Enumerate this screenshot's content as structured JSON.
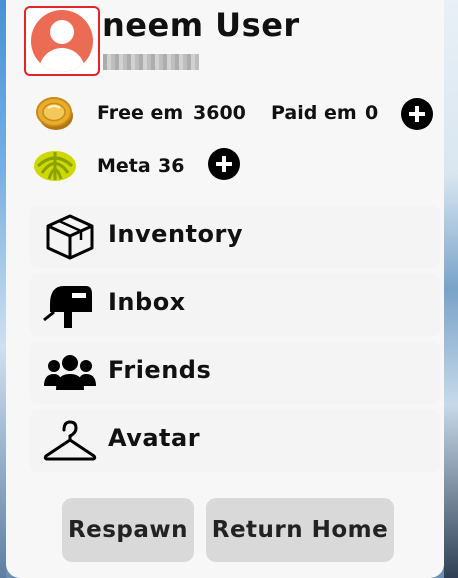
{
  "profile": {
    "username": "neem User",
    "avatar_icon": "user-avatar-icon"
  },
  "currency": {
    "free_label": "Free em",
    "free_value": "3600",
    "paid_label": "Paid em",
    "paid_value": "0",
    "meta_label": "Meta",
    "meta_value": "36"
  },
  "menu": {
    "items": [
      {
        "label": "Inventory",
        "icon": "box-icon"
      },
      {
        "label": "Inbox",
        "icon": "mailbox-icon"
      },
      {
        "label": "Friends",
        "icon": "people-icon"
      },
      {
        "label": "Avatar",
        "icon": "hanger-icon"
      }
    ]
  },
  "actions": {
    "respawn_label": "Respawn",
    "return_home_label": "Return Home"
  },
  "colors": {
    "accent_red": "#e0262a",
    "avatar_bg": "#ec6b55",
    "coin_gold": "#e2a52b",
    "meta_green": "#c9d400"
  }
}
